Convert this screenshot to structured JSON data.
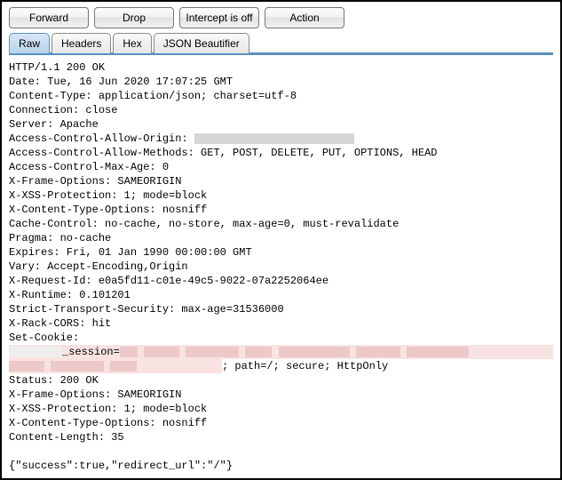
{
  "toolbar": {
    "forward": "Forward",
    "drop": "Drop",
    "intercept": "Intercept is off",
    "action": "Action"
  },
  "tabs": {
    "raw": "Raw",
    "headers": "Headers",
    "hex": "Hex",
    "json": "JSON Beautifier"
  },
  "http": {
    "status_line": "HTTP/1.1 200 OK",
    "date": "Date: Tue, 16 Jun 2020 17:07:25 GMT",
    "content_type": "Content-Type: application/json; charset=utf-8",
    "connection": "Connection: close",
    "server": "Server: Apache",
    "acao_label": "Access-Control-Allow-Origin: ",
    "acam": "Access-Control-Allow-Methods: GET, POST, DELETE, PUT, OPTIONS, HEAD",
    "acma": "Access-Control-Max-Age: 0",
    "xfo": "X-Frame-Options: SAMEORIGIN",
    "xss": "X-XSS-Protection: 1; mode=block",
    "xcto": "X-Content-Type-Options: nosniff",
    "cache": "Cache-Control: no-cache, no-store, max-age=0, must-revalidate",
    "pragma": "Pragma: no-cache",
    "expires": "Expires: Fri, 01 Jan 1990 00:00:00 GMT",
    "vary": "Vary: Accept-Encoding,Origin",
    "reqid": "X-Request-Id: e0a5fd11-c01e-49c5-9022-07a2252064ee",
    "runtime": "X-Runtime: 0.101201",
    "sts": "Strict-Transport-Security: max-age=31536000",
    "rack": "X-Rack-CORS: hit",
    "setcookie": "Set-Cookie:",
    "session_mid": "_session=",
    "cookie_tail": "; path=/; secure; HttpOnly",
    "status2": "Status: 200 OK",
    "xfo2": "X-Frame-Options: SAMEORIGIN",
    "xss2": "X-XSS-Protection: 1; mode=block",
    "xcto2": "X-Content-Type-Options: nosniff",
    "clen": "Content-Length: 35",
    "body": "{\"success\":true,\"redirect_url\":\"/\"}"
  }
}
